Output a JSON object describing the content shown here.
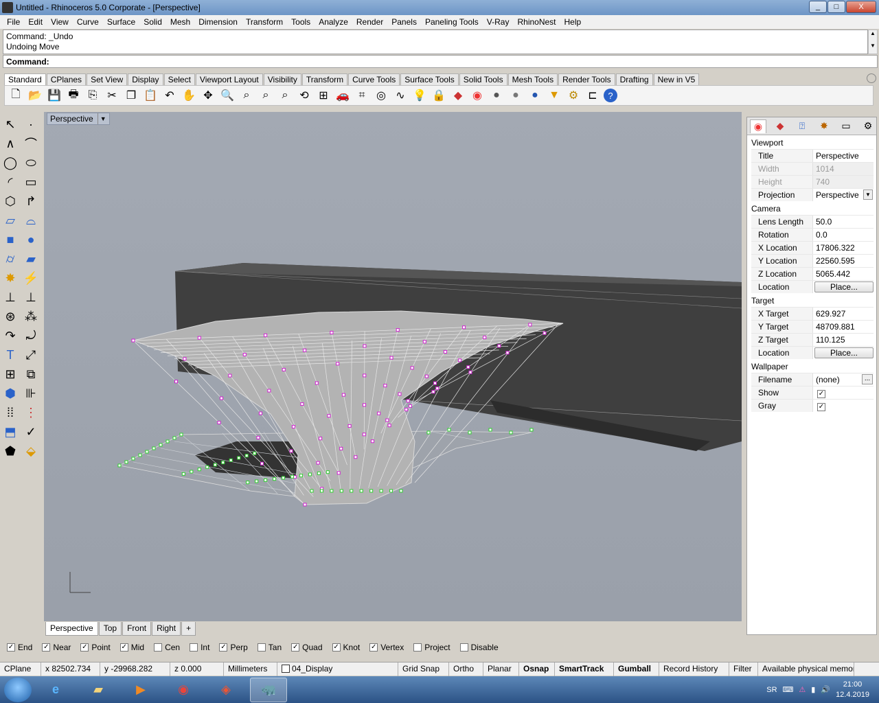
{
  "window": {
    "title": "Untitled - Rhinoceros  5.0 Corporate - [Perspective]",
    "min": "_",
    "max": "□",
    "close": "X"
  },
  "menu": [
    "File",
    "Edit",
    "View",
    "Curve",
    "Surface",
    "Solid",
    "Mesh",
    "Dimension",
    "Transform",
    "Tools",
    "Analyze",
    "Render",
    "Panels",
    "Paneling Tools",
    "V-Ray",
    "RhinoNest",
    "Help"
  ],
  "command": {
    "history": [
      "Command: _Undo",
      "Undoing Move"
    ],
    "prompt": "Command:"
  },
  "toolbar_tabs": [
    "Standard",
    "CPlanes",
    "Set View",
    "Display",
    "Select",
    "Viewport Layout",
    "Visibility",
    "Transform",
    "Curve Tools",
    "Surface Tools",
    "Solid Tools",
    "Mesh Tools",
    "Render Tools",
    "Drafting",
    "New in V5"
  ],
  "toolbar_icons": [
    "new-icon",
    "open-icon",
    "save-icon",
    "print-icon",
    "import-icon",
    "cut-icon",
    "copy-icon",
    "paste-icon",
    "undo-icon",
    "pan-icon",
    "move-view-icon",
    "zoom-icon",
    "zoom-window-icon",
    "zoom-extents-icon",
    "zoom-selected-icon",
    "rotate-view-icon",
    "four-views-icon",
    "car-icon",
    "mesh-icon",
    "circle-icon",
    "curve-icon",
    "light-icon",
    "lock-icon",
    "layer-icon",
    "color-wheel-icon",
    "sphere-icon",
    "sphere-icon",
    "sphere-icon",
    "spotlight-icon",
    "settings-icon",
    "dimension-icon",
    "help-icon"
  ],
  "viewport": {
    "name": "Perspective",
    "axes": "z y x"
  },
  "viewport_tabs": [
    "Perspective",
    "Top",
    "Front",
    "Right",
    "+"
  ],
  "properties": {
    "viewport_section": "Viewport",
    "title_label": "Title",
    "title_value": "Perspective",
    "width_label": "Width",
    "width_value": "1014",
    "height_label": "Height",
    "height_value": "740",
    "projection_label": "Projection",
    "projection_value": "Perspective",
    "camera_section": "Camera",
    "lens_label": "Lens Length",
    "lens_value": "50.0",
    "rotation_label": "Rotation",
    "rotation_value": "0.0",
    "xloc_label": "X Location",
    "xloc_value": "17806.322",
    "yloc_label": "Y Location",
    "yloc_value": "22560.595",
    "zloc_label": "Z Location",
    "zloc_value": "5065.442",
    "location_label": "Location",
    "place_label": "Place...",
    "target_section": "Target",
    "xt_label": "X Target",
    "xt_value": "629.927",
    "yt_label": "Y Target",
    "yt_value": "48709.881",
    "zt_label": "Z Target",
    "zt_value": "110.125",
    "wallpaper_section": "Wallpaper",
    "filename_label": "Filename",
    "filename_value": "(none)",
    "show_label": "Show",
    "gray_label": "Gray"
  },
  "osnaps": [
    {
      "label": "End",
      "checked": true
    },
    {
      "label": "Near",
      "checked": true
    },
    {
      "label": "Point",
      "checked": true
    },
    {
      "label": "Mid",
      "checked": true
    },
    {
      "label": "Cen",
      "checked": false
    },
    {
      "label": "Int",
      "checked": false
    },
    {
      "label": "Perp",
      "checked": true
    },
    {
      "label": "Tan",
      "checked": false
    },
    {
      "label": "Quad",
      "checked": true
    },
    {
      "label": "Knot",
      "checked": true
    },
    {
      "label": "Vertex",
      "checked": true
    },
    {
      "label": "Project",
      "checked": false
    },
    {
      "label": "Disable",
      "checked": false
    }
  ],
  "status": {
    "cplane": "CPlane",
    "x": "x 82502.734",
    "y": "y -29968.282",
    "z": "z 0.000",
    "units": "Millimeters",
    "layer": "04_Display",
    "grid_snap": "Grid Snap",
    "ortho": "Ortho",
    "planar": "Planar",
    "osnap": "Osnap",
    "smarttrack": "SmartTrack",
    "gumball": "Gumball",
    "record": "Record History",
    "filter": "Filter",
    "memory": "Available physical memor..."
  },
  "taskbar": {
    "lang": "SR",
    "time": "21:00",
    "date": "12.4.2019"
  }
}
